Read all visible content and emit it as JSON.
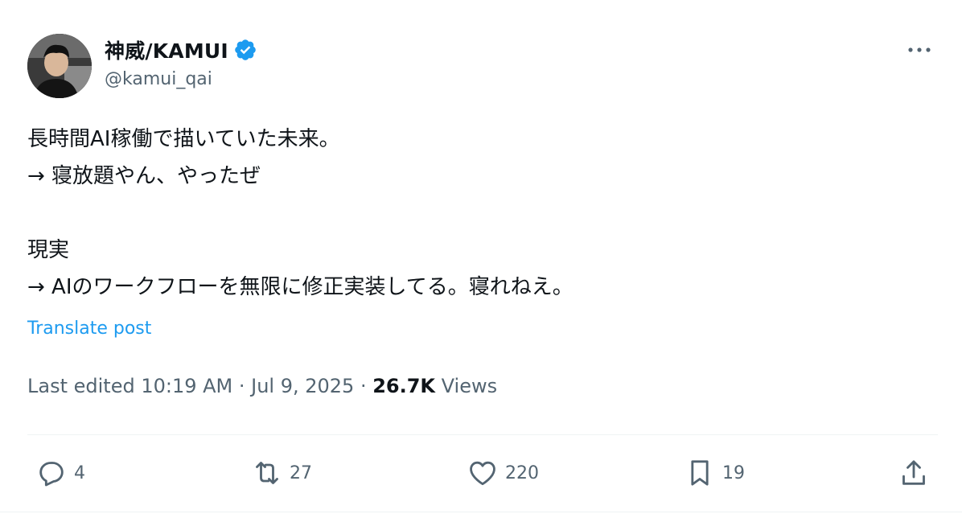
{
  "author": {
    "display_name": "神威/KAMUI",
    "handle": "@kamui_qai",
    "verified": true,
    "avatar_icon": "avatar-photo"
  },
  "more_icon": "more-horizontal-icon",
  "body": {
    "lines": [
      "長時間AI稼働で描いていた未来。",
      "→ 寝放題やん、やったぜ",
      "",
      "現実",
      "→ AIのワークフローを無限に修正実装してる。寝れねえ。"
    ]
  },
  "translate_label": "Translate post",
  "meta": {
    "edited_label": "Last edited 10:19 AM · Jul 9, 2025 · ",
    "views_count": "26.7K",
    "views_label": " Views"
  },
  "actions": {
    "reply": {
      "icon": "reply-icon",
      "count": "4"
    },
    "repost": {
      "icon": "repost-icon",
      "count": "27"
    },
    "like": {
      "icon": "heart-icon",
      "count": "220"
    },
    "bookmark": {
      "icon": "bookmark-icon",
      "count": "19"
    },
    "share": {
      "icon": "share-icon"
    }
  },
  "colors": {
    "text": "#0f1419",
    "secondary": "#536471",
    "accent": "#1d9bf0",
    "divider": "#eff3f4"
  }
}
